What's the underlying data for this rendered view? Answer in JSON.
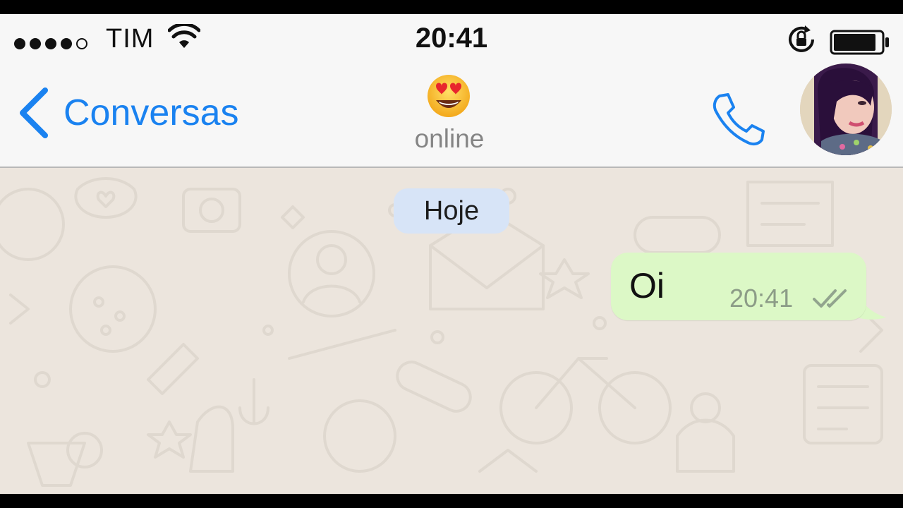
{
  "status_bar": {
    "carrier": "TIM",
    "time": "20:41",
    "signal_bars_filled": 4,
    "signal_bars_total": 5,
    "battery_level": 0.9
  },
  "nav": {
    "back_label": "Conversas",
    "title_icon": "heart-eyes-emoji",
    "contact_status": "online",
    "call_icon": "phone-icon"
  },
  "chat": {
    "date_label": "Hoje",
    "messages": [
      {
        "text": "Oi",
        "time": "20:41",
        "status": "read",
        "direction": "outgoing"
      }
    ]
  },
  "colors": {
    "accent": "#1a82f0",
    "outgoing_bubble": "#dcf8c6",
    "date_pill": "#d7e4f7",
    "chat_background": "#ece5dd"
  }
}
